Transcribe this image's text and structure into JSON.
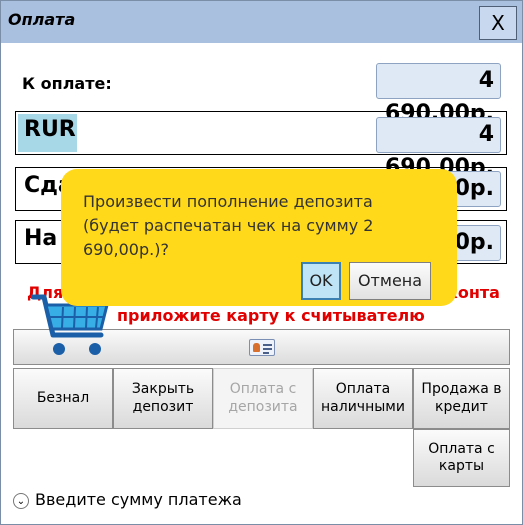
{
  "window": {
    "title": "Оплата",
    "close_label": "X"
  },
  "to_pay": {
    "label": "К оплате:",
    "amount": "4 690,00р."
  },
  "currency": {
    "code": "RUR",
    "amount": "4 690,00р."
  },
  "change": {
    "label": "Сда",
    "amount": "0,00р."
  },
  "deposit_row": {
    "label": "На",
    "amount": "0,00р."
  },
  "notice": {
    "line1_left": "Для",
    "line1_right": "конта",
    "line2": "приложите карту к считывателю"
  },
  "buttons": {
    "beznal": "Безнал",
    "close_deposit": "Закрыть депозит",
    "pay_from_deposit": "Оплата с депозита",
    "cash": "Оплата наличными",
    "credit_sale": "Продажа в кредит",
    "card_payment": "Оплата с карты"
  },
  "hint": {
    "text": "Введите сумму платежа"
  },
  "dialog": {
    "message": "Произвести пополнение депозита (будет распечатан чек на сумму 2 690,00р.)?",
    "ok_label": "OK",
    "cancel_label": "Отмена"
  },
  "icons": [
    "close-icon",
    "id-card-icon",
    "shopping-cart-icon",
    "chevron-down-icon"
  ],
  "colors": {
    "titlebar": "#a9c0df",
    "dialog": "#ffd91a",
    "notice": "#e00000",
    "currency_highlight": "#a7d8e8"
  }
}
